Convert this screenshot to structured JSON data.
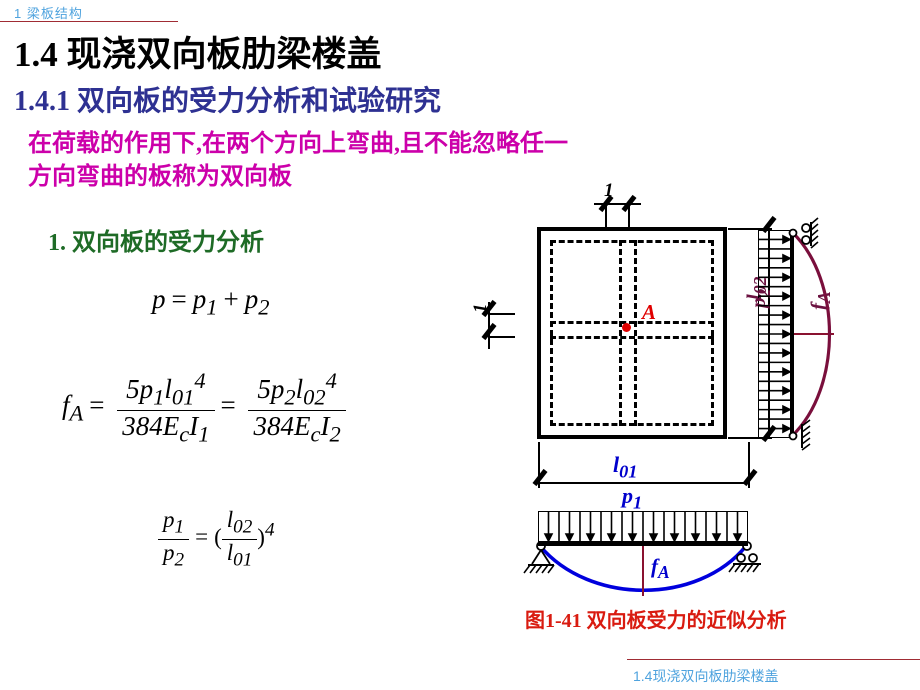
{
  "header": {
    "label": "1  梁板结构",
    "rule_color": "#A02C34",
    "text_color": "#4FA3DE"
  },
  "title": {
    "main": "1.4 现浇双向板肋梁楼盖",
    "main_color": "#000000",
    "section": "1.4.1 双向板的受力分析和试验研究",
    "section_color": "#2E3192"
  },
  "definition": {
    "line1": "在荷载的作用下,在两个方向上弯曲,且不能忽略任一",
    "line2": "方向弯曲的板称为双向板",
    "color": "#CC00AA"
  },
  "subsection": {
    "label": "1. 双向板的受力分析",
    "color": "#1E6B26"
  },
  "equations": {
    "load": {
      "lhs": "p",
      "eq": "=",
      "t1": "p",
      "t1sub": "1",
      "plus": "+",
      "t2": "p",
      "t2sub": "2"
    },
    "deflection": {
      "lhs": "f",
      "lhs_sub": "A",
      "eq": "=",
      "num1": "5",
      "num1_p": "p",
      "num1_psub": "1",
      "num1_l": "l",
      "num1_lsub": "01",
      "num1_lsup": "4",
      "den1": "384",
      "den1_E": "E",
      "den1_Esub": "c",
      "den1_I": "I",
      "den1_Isub": "1",
      "eq2": "=",
      "num2": "5",
      "num2_p": "p",
      "num2_psub": "2",
      "num2_l": "l",
      "num2_lsub": "02",
      "num2_lsup": "4",
      "den2": "384",
      "den2_E": "E",
      "den2_Esub": "c",
      "den2_I": "I",
      "den2_Isub": "2"
    },
    "ratio": {
      "num_p": "p",
      "num_psub": "1",
      "den_p": "p",
      "den_psub": "2",
      "eq": "=",
      "open": "(",
      "close": ")",
      "inner_num_l": "l",
      "inner_num_sub": "02",
      "inner_den_l": "l",
      "inner_den_sub": "01",
      "exponent": "4"
    }
  },
  "figure": {
    "section_mark_top": "1",
    "section_mark_left": "1",
    "point_label": "A",
    "point_color": "#E00000",
    "dim_l02": "l",
    "dim_l02_sub": "02",
    "dim_l02_color": "#6B1140",
    "dim_l01": "l",
    "dim_l01_sub": "01",
    "dim_l01_color": "#0000CC",
    "load_p2": "p",
    "load_p2_sub": "2",
    "load_p2_color": "#6B1140",
    "load_p1": "p",
    "load_p1_sub": "1",
    "load_p1_color": "#0000CC",
    "deflection_v": "f",
    "deflection_v_sub": "A",
    "deflection_h": "f",
    "deflection_h_sub": "A",
    "curve_v_color": "#7A0F3C",
    "curve_h_color": "#0000DD",
    "caption": "图1-41  双向板受力的近似分析",
    "caption_color": "#D91B10"
  },
  "footer": {
    "label": "1.4现浇双向板肋梁楼盖",
    "rule_color": "#A02C34",
    "text_color": "#4FA3DE"
  }
}
